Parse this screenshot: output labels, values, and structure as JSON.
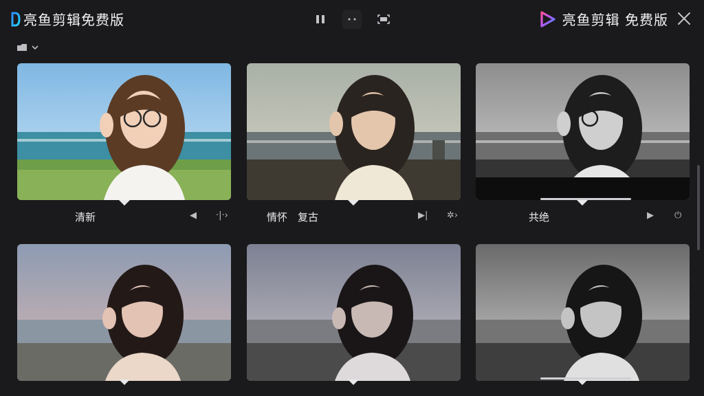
{
  "app": {
    "title_left": "亮鱼剪辑免费版",
    "title_right": "亮鱼剪辑 免费版"
  },
  "icons": {
    "pause": "pause-icon",
    "more": "more-icon",
    "screen": "screen-capture-icon",
    "close": "close-icon",
    "filter": "folder-icon",
    "dropdown": "chevron-down-icon"
  },
  "cards": [
    {
      "label": "清新",
      "ctrl_a": "◀",
      "ctrl_b": "·|·›"
    },
    {
      "label": "情怀　复古",
      "ctrl_a": "▶|",
      "ctrl_b": "✲›"
    },
    {
      "label": "共绝",
      "ctrl_a": "▶",
      "ctrl_b": "⏻"
    },
    {
      "label": "",
      "ctrl_a": "",
      "ctrl_b": ""
    },
    {
      "label": "",
      "ctrl_a": "",
      "ctrl_b": ""
    },
    {
      "label": "",
      "ctrl_a": "",
      "ctrl_b": ""
    }
  ],
  "colors": {
    "background": "#1a1a1c",
    "accent_blue": "#2f8cff",
    "accent_pink": "#ff4f9a"
  }
}
